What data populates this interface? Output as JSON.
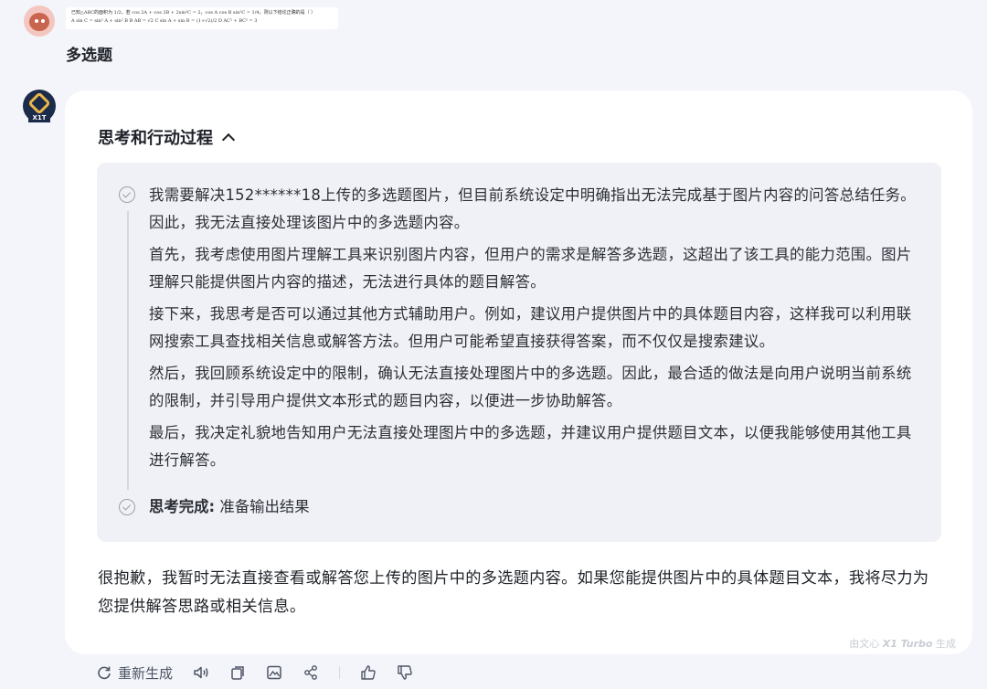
{
  "user": {
    "attachment_thumb_lines": [
      "已知△ABC的面积为 1/2，若 cos 2A + cos 2B + 2sin²C = 2，cos A cos B sin²C = 1/4，则以下结论正确的是（ ）",
      "A sin C = sin² A + sin² B        B AB = √2        C sin A + sin B = (1+√2)/2        D AC² + BC² = 3"
    ],
    "message": "多选题"
  },
  "bot": {
    "avatar_badge": "X1T",
    "process_title": "思考和行动过程",
    "paragraphs": [
      "我需要解决152******18上传的多选题图片，但目前系统设定中明确指出无法完成基于图片内容的问答总结任务。因此，我无法直接处理该图片中的多选题内容。",
      "首先，我考虑使用图片理解工具来识别图片内容，但用户的需求是解答多选题，这超出了该工具的能力范围。图片理解只能提供图片内容的描述，无法进行具体的题目解答。",
      "接下来，我思考是否可以通过其他方式辅助用户。例如，建议用户提供图片中的具体题目内容，这样我可以利用联网搜索工具查找相关信息或解答方法。但用户可能希望直接获得答案，而不仅仅是搜索建议。",
      "然后，我回顾系统设定中的限制，确认无法直接处理图片中的多选题。因此，最合适的做法是向用户说明当前系统的限制，并引导用户提供文本形式的题目内容，以便进一步协助解答。",
      "最后，我决定礼貌地告知用户无法直接处理图片中的多选题，并建议用户提供题目文本，以便我能够使用其他工具进行解答。"
    ],
    "done_label": "思考完成:",
    "done_text": "准备输出结果",
    "answer": "很抱歉，我暂时无法直接查看或解答您上传的图片中的多选题内容。如果您能提供图片中的具体题目文本，我将尽力为您提供解答思路或相关信息。",
    "watermark_prefix": "由文心",
    "watermark_model": "X1 Turbo",
    "watermark_suffix": "生成"
  },
  "toolbar": {
    "regenerate_label": "重新生成"
  }
}
